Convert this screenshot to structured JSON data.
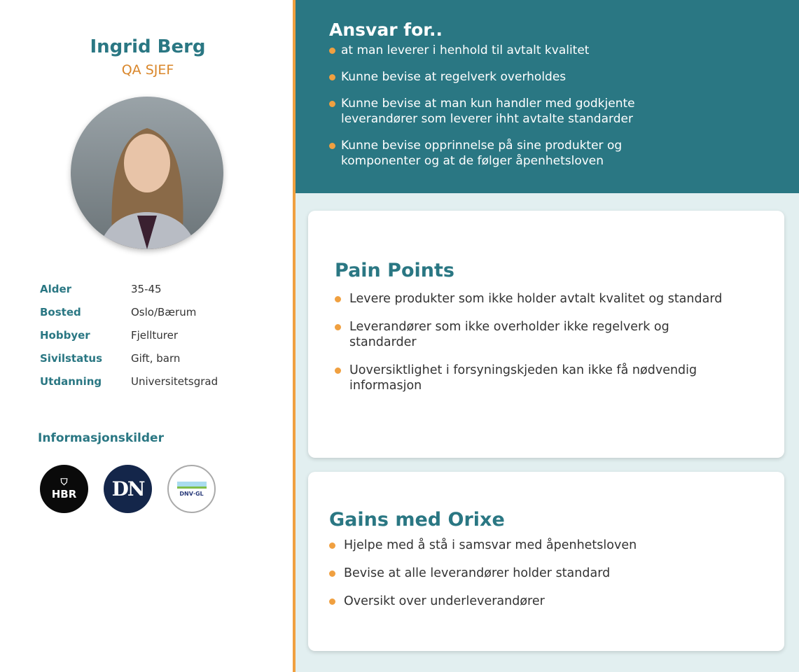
{
  "profile": {
    "name": "Ingrid Berg",
    "role": "QA SJEF",
    "facts": [
      {
        "k": "Alder",
        "v": "35-45"
      },
      {
        "k": "Bosted",
        "v": "Oslo/Bærum"
      },
      {
        "k": "Hobbyer",
        "v": "Fjellturer"
      },
      {
        "k": "Sivilstatus",
        "v": "Gift, barn"
      },
      {
        "k": "Utdanning",
        "v": "Universitetsgrad"
      }
    ],
    "sources_title": "Informasjonskilder",
    "sources": [
      {
        "label": "HBR"
      },
      {
        "label": "DN"
      },
      {
        "label": "DNV·GL"
      }
    ]
  },
  "responsibilities": {
    "title": "Ansvar for..",
    "items": [
      "at man leverer i henhold til avtalt kvalitet",
      "Kunne bevise at regelverk overholdes",
      "Kunne bevise at man kun handler med godkjente leverandører som leverer ihht avtalte standarder",
      "Kunne bevise opprinnelse på sine produkter og komponenter og at de følger åpenhetsloven"
    ]
  },
  "pain_points": {
    "title": "Pain Points",
    "items": [
      "Levere produkter som ikke holder avtalt kvalitet og standard",
      "Leverandører som ikke overholder ikke regelverk og standarder",
      "Uoversiktlighet i forsyningskjeden kan ikke få nødvendig informasjon"
    ]
  },
  "gains": {
    "title": "Gains med Orixe",
    "items": [
      "Hjelpe med å stå i samsvar med åpenhetsloven",
      "Bevise at alle leverandører holder standard",
      "Oversikt over underleverandører"
    ]
  },
  "colors": {
    "teal": "#2a7783",
    "orange": "#f0a040"
  }
}
